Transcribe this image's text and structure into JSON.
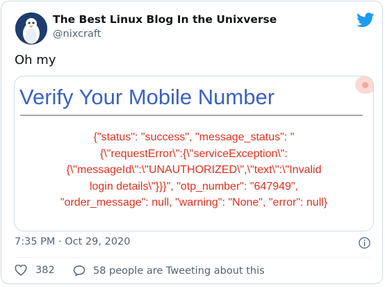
{
  "author": {
    "name": "The Best Linux Blog In the Unixverse",
    "handle": "@nixcraft"
  },
  "tweet": {
    "text": "Oh my",
    "timestamp": "7:35 PM · Oct 29, 2020"
  },
  "media": {
    "heading": "Verify Your Mobile Number",
    "body_lines": [
      "{\"status\": \"success\", \"message_status\": \"",
      "{\\\"requestError\\\":{\\\"serviceException\\\":",
      "{\\\"messageId\\\":\\\"UNAUTHORIZED\\\",\\\"text\\\":\\\"Invalid",
      "login details\\\"}}}\", \"otp_number\": \"647949\",",
      "\"order_message\": null, \"warning\": \"None\", \"error\": null}"
    ]
  },
  "stats": {
    "likes": "382",
    "conversation": "58 people are Tweeting about this"
  },
  "colors": {
    "heading_blue": "#3a62c0",
    "error_red": "#e0301e",
    "twitter_blue": "#1d9bf0",
    "secondary_text": "#536471"
  },
  "icons": [
    "avatar-penguin",
    "twitter-bird-icon",
    "info-icon",
    "heart-icon",
    "speech-bubble-icon"
  ]
}
